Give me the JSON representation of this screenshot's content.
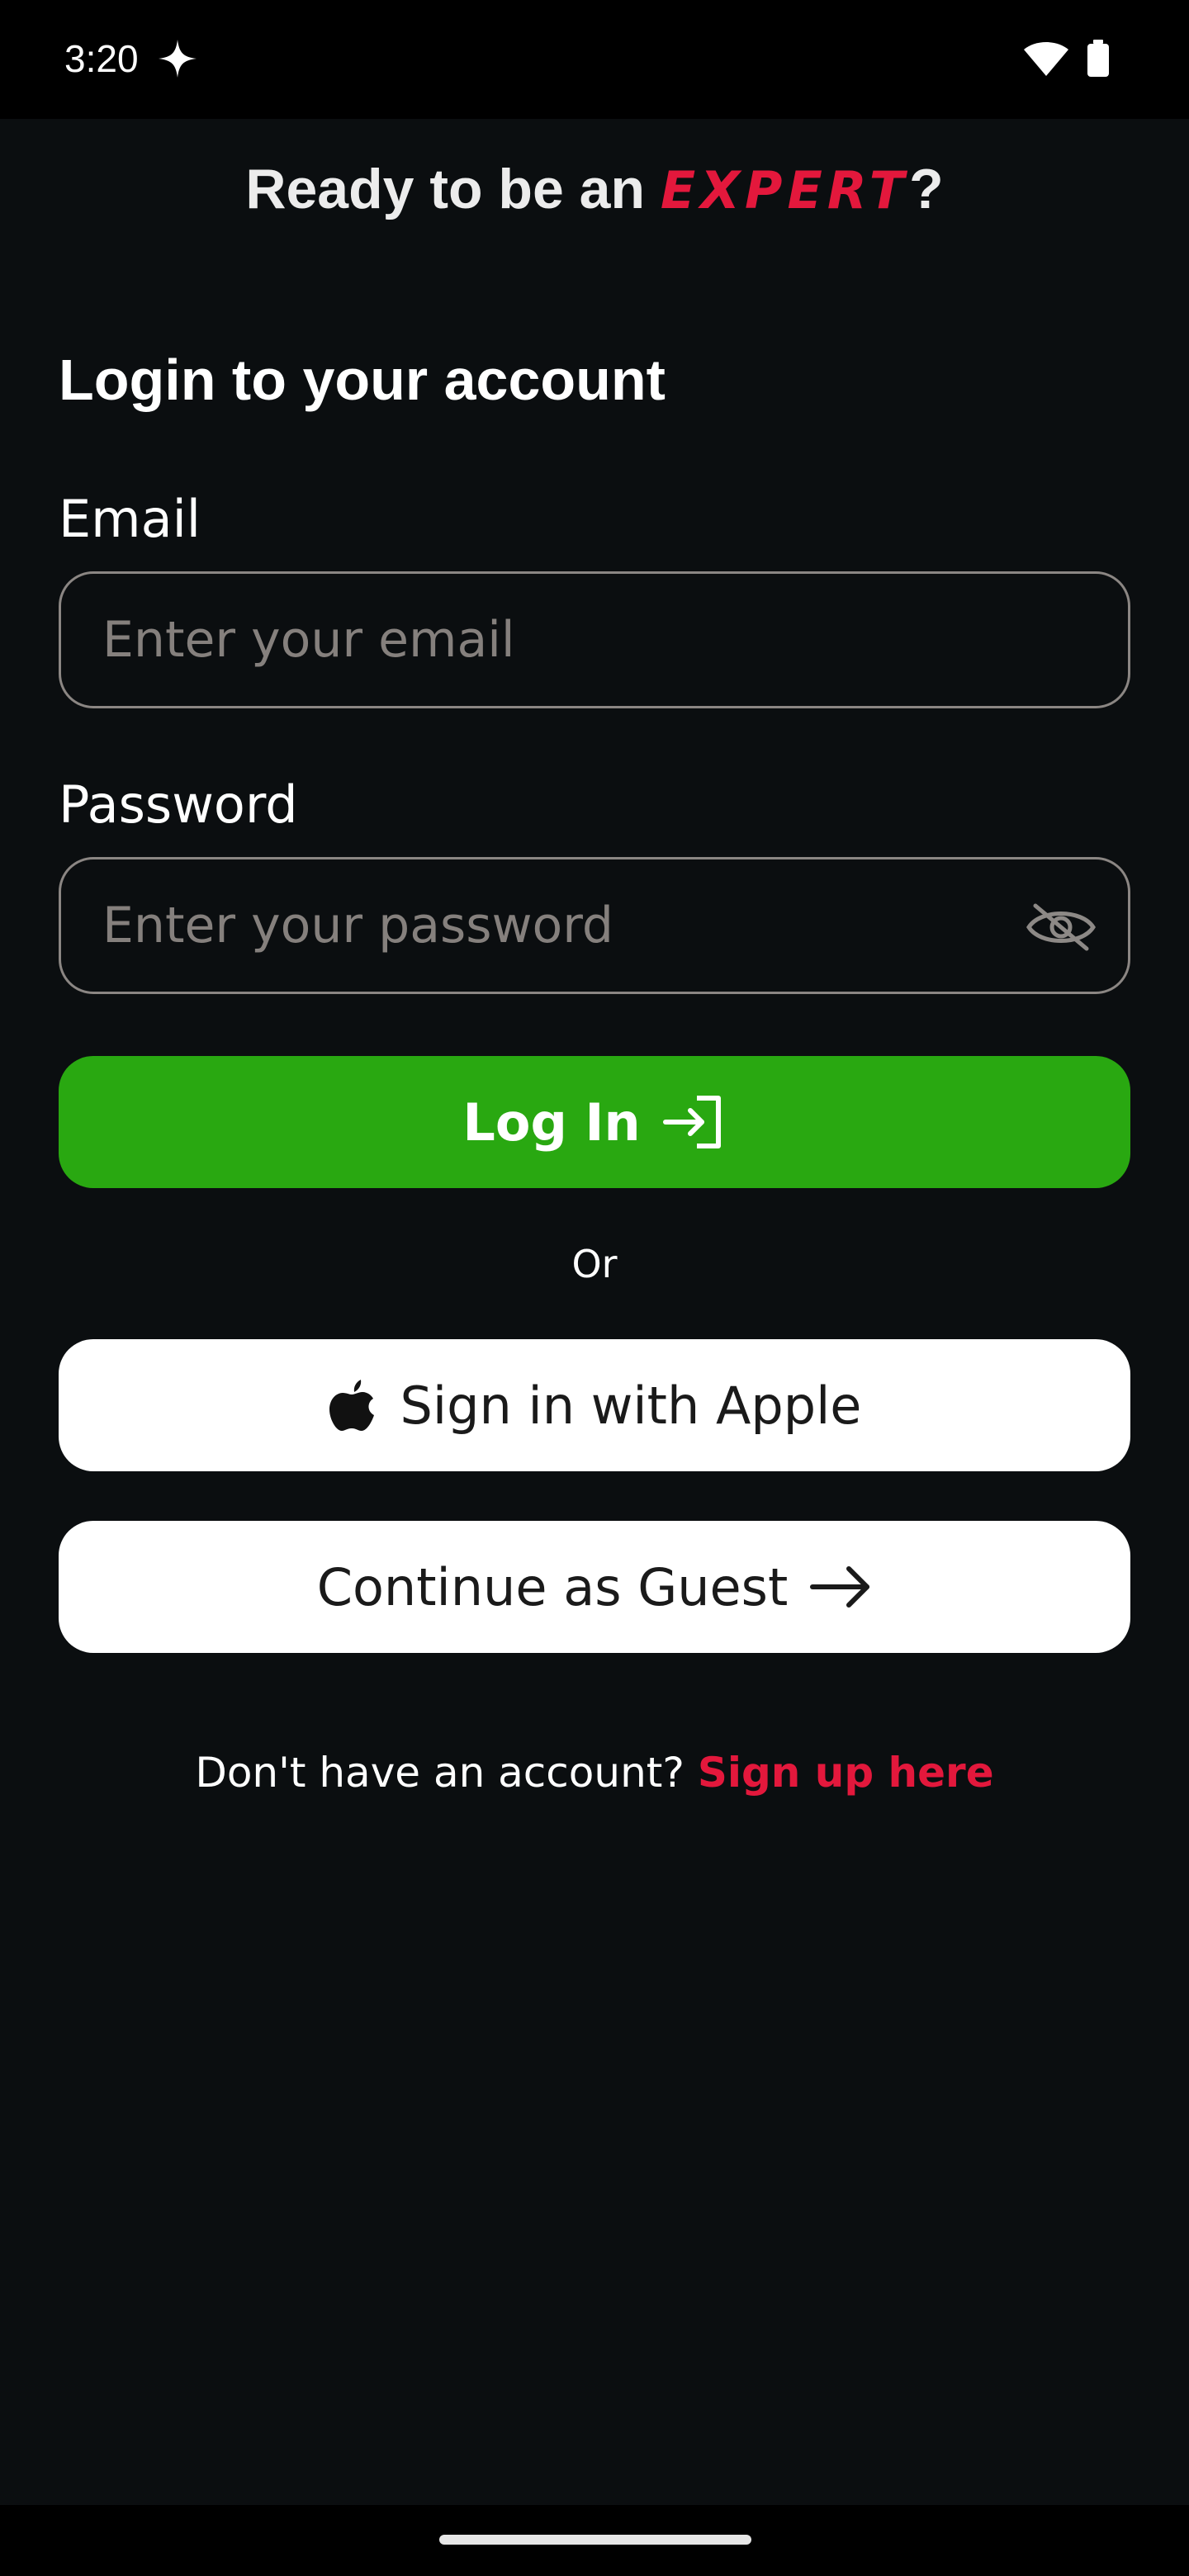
{
  "status_bar": {
    "time": "3:20"
  },
  "header": {
    "headline_prefix": "Ready to be an ",
    "brand_word": "EXPERT",
    "headline_suffix": "?",
    "brand_color": "#e3183c"
  },
  "form": {
    "title": "Login to your account",
    "email": {
      "label": "Email",
      "placeholder": "Enter your email",
      "value": ""
    },
    "password": {
      "label": "Password",
      "placeholder": "Enter your password",
      "value": "",
      "toggle_icon": "eye-off-icon"
    },
    "login_button": {
      "label": "Log In",
      "icon": "login-icon",
      "color": "#29a811"
    },
    "divider_text": "Or",
    "apple_button": {
      "label": "Sign in with Apple",
      "icon": "apple-icon"
    },
    "guest_button": {
      "label": "Continue as Guest",
      "icon": "arrow-right-icon"
    }
  },
  "footer": {
    "prompt": "Don't have an account?",
    "signup_link": "Sign up here"
  }
}
